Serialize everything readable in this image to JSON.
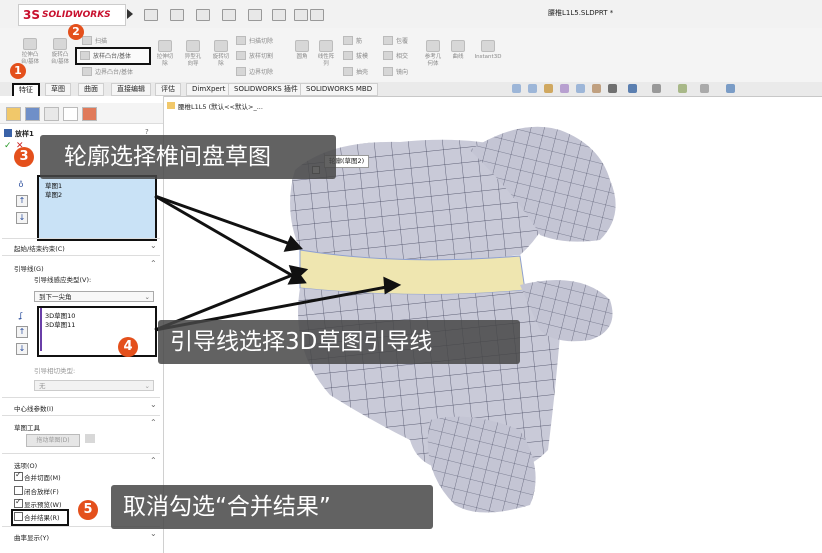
{
  "app": {
    "logo_ds": "3S",
    "logo_text": "SOLIDWORKS",
    "file_title": "腰椎L1L5.SLDPRT *"
  },
  "commands": {
    "extrude_boss": "拉伸凸\n台/基体",
    "revolve_boss": "旋转凸\n台/基体",
    "sweep": "扫描",
    "loft_boss": "放样凸台/基体",
    "boundary_boss": "边界凸台/基体",
    "extrude_cut": "拉伸切\n除",
    "hole_wizard": "异型孔\n向导",
    "revolve_cut": "旋转切\n除",
    "swept_cut": "扫描切除",
    "lofted_cut": "放样切割",
    "boundary_cut": "边界切除",
    "fillet": "圆角",
    "linear_pattern": "线性阵\n列",
    "rib": "筋",
    "draft": "拔模",
    "shell": "抽壳",
    "wrap": "包覆",
    "intersect": "相交",
    "mirror": "镜向",
    "ref_geometry": "参考几\n何体",
    "curves": "曲线",
    "instant3d": "Instant3D"
  },
  "tabs": [
    "特征",
    "草图",
    "曲面",
    "直接编辑",
    "评估",
    "DimXpert",
    "SOLIDWORKS 插件",
    "SOLIDWORKS MBD"
  ],
  "tree_path": "腰椎L1L5 (默认<<默认>_...",
  "panel": {
    "feature_title": "放样1",
    "help": "?",
    "profiles": [
      "草图1",
      "草图2"
    ],
    "start_end_constraints": "起始/结束约束(C)",
    "guide_curves": "引导线(G)",
    "guide_influence_label": "引导线感应类型(V):",
    "guide_influence_value": "到下一尖角",
    "guide_items": [
      "3D草图10",
      "3D草图11"
    ],
    "guide_tangency_label": "引导相切类型:",
    "guide_tangency_value": "无",
    "centerline": "中心线参数(I)",
    "sketch_tools": "草图工具",
    "drag_sketch": "拖动草图(D)",
    "options": "选项(O)",
    "opt_merge_tangent": "合并切面(M)",
    "opt_close_loft": "闭合放样(F)",
    "opt_show_preview": "显示预览(W)",
    "opt_merge_result": "合并结果(R)",
    "curvature_display": "曲率显示(Y)",
    "checked": {
      "merge_tangent": true,
      "close_loft": false,
      "show_preview": true,
      "merge_result": false
    }
  },
  "model_tag": "轮廓(草图2)",
  "callouts": {
    "c3": "轮廓选择椎间盘草图",
    "c4": "引导线选择3D草图引导线",
    "c5": "取消勾选“合并结果”"
  },
  "badges": [
    "1",
    "2",
    "3",
    "4",
    "5"
  ],
  "colors": {
    "badge": "#e4501c",
    "accent": "#2a4d9c",
    "model": "#c9cad8",
    "disc": "#efe6b0"
  }
}
